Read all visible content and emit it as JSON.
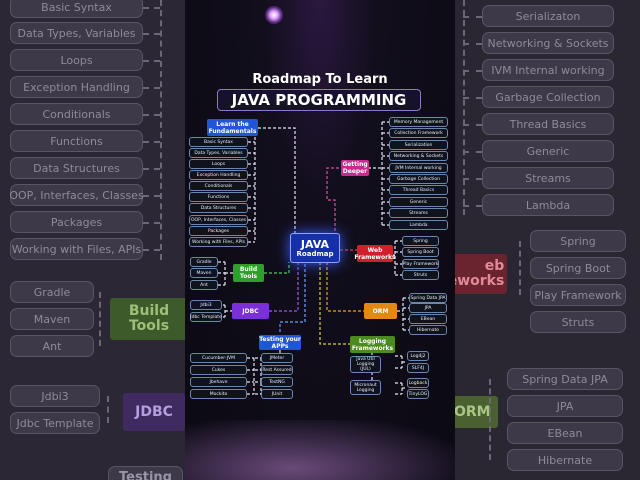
{
  "title": {
    "line1": "Roadmap To Learn",
    "line2": "JAVA PROGRAMMING"
  },
  "hub": {
    "line1": "JAVA",
    "line2": "Roadmap"
  },
  "fundamentals": {
    "label": "Learn the Fundamentals",
    "items": [
      "Basic Syntax",
      "Data Types, Variables",
      "Loops",
      "Exception Handling",
      "Conditionals",
      "Functions",
      "Data Structures",
      "OOP, Interfaces, Classes",
      "Packages",
      "Working with Files, APIs"
    ]
  },
  "build_tools": {
    "label": "Build Tools",
    "items": [
      "Gradle",
      "Maven",
      "Ant"
    ]
  },
  "jdbc": {
    "label": "JDBC",
    "items": [
      "Jdbi3",
      "Jdbc Template"
    ]
  },
  "testing": {
    "label": "Testing your APPs",
    "items_left": [
      "Cucumber-JVM",
      "Cukes",
      "Jbehave",
      "Mockito"
    ],
    "items_right": [
      "JMeter",
      "Rest Assured",
      "TestNG",
      "JUnit"
    ]
  },
  "getting_deeper": {
    "label": "Getting Deeper",
    "items": [
      "Memory Management",
      "Collection Framework",
      "Serialization",
      "Networking & Sockets",
      "JVM Internal working",
      "Garbage Collection",
      "Thread Basics",
      "Generic",
      "Streams",
      "Lambda"
    ]
  },
  "web_frameworks": {
    "label": "Web Frameworks",
    "items": [
      "Spring",
      "Spring Boot",
      "Play Framework",
      "Struts"
    ]
  },
  "orm": {
    "label": "ORM",
    "items": [
      "Spring Data JPA",
      "JPA",
      "EBean",
      "Hibernate"
    ]
  },
  "logging": {
    "label": "Logging Frameworks",
    "group1_label": "Java Util Logging (JUL)",
    "group1_items": [
      "Log4j2",
      "SLF4J"
    ],
    "group2_label": "Micronaut Logging",
    "group2_items": [
      "Logback",
      "TinyLOG"
    ]
  },
  "left_bg": {
    "items": [
      "Basic Syntax",
      "Data Types, Variables",
      "Loops",
      "Exception Handling",
      "Conditionals",
      "Functions",
      "Data Structures",
      "OOP, Interfaces, Classes",
      "Packages",
      "Working with Files, APIs"
    ],
    "build_items": [
      "Gradle",
      "Maven",
      "Ant"
    ],
    "build_label": "Build Tools",
    "jdbc_items": [
      "Jdbi3",
      "Jdbc Template"
    ],
    "jdbc_label": "JDBC",
    "testing_label": "Testing"
  },
  "right_bg": {
    "items": [
      "Serializaton",
      "Networking & Sockets",
      "IVM Internal working",
      "Garbage Collection",
      "Thread Basics",
      "Generic",
      "Streams",
      "Lambda"
    ],
    "web_items": [
      "Spring",
      "Spring Boot",
      "Play Framework",
      "Struts"
    ],
    "web_label_1": "eb",
    "web_label_2": "eworks",
    "orm_items": [
      "Spring Data JPA",
      "JPA",
      "EBean",
      "Hibernate"
    ],
    "orm_label": "ORM"
  },
  "colors": {
    "background": "#0c0a14",
    "hub_blue": "#1630a8",
    "label_blue": "#1f55d6",
    "label_red": "#d0202c",
    "label_pink": "#c82a8e",
    "label_green": "#2f9e2a",
    "label_purple": "#7a2fd8",
    "label_orange": "#e38a0e",
    "item_border": "#6a87b0"
  }
}
